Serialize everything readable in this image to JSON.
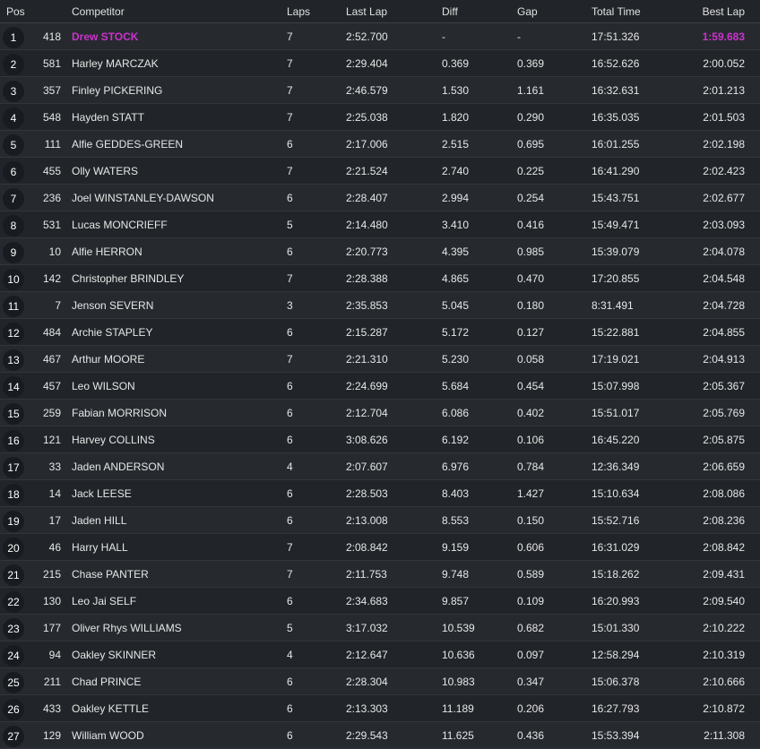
{
  "headers": {
    "pos": "Pos",
    "competitor": "Competitor",
    "laps": "Laps",
    "last_lap": "Last Lap",
    "diff": "Diff",
    "gap": "Gap",
    "total_time": "Total Time",
    "best_lap": "Best Lap"
  },
  "colors": {
    "background": "#212529",
    "row_alt": "#262a2f",
    "highlight": "#cc33cc",
    "badge": "#181b1f"
  },
  "rows": [
    {
      "pos": "1",
      "num": "418",
      "name": "Drew STOCK",
      "laps": "7",
      "last": "2:52.700",
      "diff": "-",
      "gap": "-",
      "total": "17:51.326",
      "best": "1:59.683",
      "leader": true,
      "fastest": true
    },
    {
      "pos": "2",
      "num": "581",
      "name": "Harley MARCZAK",
      "laps": "7",
      "last": "2:29.404",
      "diff": "0.369",
      "gap": "0.369",
      "total": "16:52.626",
      "best": "2:00.052"
    },
    {
      "pos": "3",
      "num": "357",
      "name": "Finley PICKERING",
      "laps": "7",
      "last": "2:46.579",
      "diff": "1.530",
      "gap": "1.161",
      "total": "16:32.631",
      "best": "2:01.213"
    },
    {
      "pos": "4",
      "num": "548",
      "name": "Hayden STATT",
      "laps": "7",
      "last": "2:25.038",
      "diff": "1.820",
      "gap": "0.290",
      "total": "16:35.035",
      "best": "2:01.503"
    },
    {
      "pos": "5",
      "num": "111",
      "name": "Alfie GEDDES-GREEN",
      "laps": "6",
      "last": "2:17.006",
      "diff": "2.515",
      "gap": "0.695",
      "total": "16:01.255",
      "best": "2:02.198"
    },
    {
      "pos": "6",
      "num": "455",
      "name": "Olly WATERS",
      "laps": "7",
      "last": "2:21.524",
      "diff": "2.740",
      "gap": "0.225",
      "total": "16:41.290",
      "best": "2:02.423"
    },
    {
      "pos": "7",
      "num": "236",
      "name": "Joel WINSTANLEY-DAWSON",
      "laps": "6",
      "last": "2:28.407",
      "diff": "2.994",
      "gap": "0.254",
      "total": "15:43.751",
      "best": "2:02.677"
    },
    {
      "pos": "8",
      "num": "531",
      "name": "Lucas MONCRIEFF",
      "laps": "5",
      "last": "2:14.480",
      "diff": "3.410",
      "gap": "0.416",
      "total": "15:49.471",
      "best": "2:03.093"
    },
    {
      "pos": "9",
      "num": "10",
      "name": "Alfie HERRON",
      "laps": "6",
      "last": "2:20.773",
      "diff": "4.395",
      "gap": "0.985",
      "total": "15:39.079",
      "best": "2:04.078"
    },
    {
      "pos": "10",
      "num": "142",
      "name": "Christopher BRINDLEY",
      "laps": "7",
      "last": "2:28.388",
      "diff": "4.865",
      "gap": "0.470",
      "total": "17:20.855",
      "best": "2:04.548"
    },
    {
      "pos": "11",
      "num": "7",
      "name": "Jenson SEVERN",
      "laps": "3",
      "last": "2:35.853",
      "diff": "5.045",
      "gap": "0.180",
      "total": "8:31.491",
      "best": "2:04.728"
    },
    {
      "pos": "12",
      "num": "484",
      "name": "Archie STAPLEY",
      "laps": "6",
      "last": "2:15.287",
      "diff": "5.172",
      "gap": "0.127",
      "total": "15:22.881",
      "best": "2:04.855"
    },
    {
      "pos": "13",
      "num": "467",
      "name": "Arthur MOORE",
      "laps": "7",
      "last": "2:21.310",
      "diff": "5.230",
      "gap": "0.058",
      "total": "17:19.021",
      "best": "2:04.913"
    },
    {
      "pos": "14",
      "num": "457",
      "name": "Leo WILSON",
      "laps": "6",
      "last": "2:24.699",
      "diff": "5.684",
      "gap": "0.454",
      "total": "15:07.998",
      "best": "2:05.367"
    },
    {
      "pos": "15",
      "num": "259",
      "name": "Fabian MORRISON",
      "laps": "6",
      "last": "2:12.704",
      "diff": "6.086",
      "gap": "0.402",
      "total": "15:51.017",
      "best": "2:05.769"
    },
    {
      "pos": "16",
      "num": "121",
      "name": "Harvey COLLINS",
      "laps": "6",
      "last": "3:08.626",
      "diff": "6.192",
      "gap": "0.106",
      "total": "16:45.220",
      "best": "2:05.875"
    },
    {
      "pos": "17",
      "num": "33",
      "name": "Jaden ANDERSON",
      "laps": "4",
      "last": "2:07.607",
      "diff": "6.976",
      "gap": "0.784",
      "total": "12:36.349",
      "best": "2:06.659"
    },
    {
      "pos": "18",
      "num": "14",
      "name": "Jack LEESE",
      "laps": "6",
      "last": "2:28.503",
      "diff": "8.403",
      "gap": "1.427",
      "total": "15:10.634",
      "best": "2:08.086"
    },
    {
      "pos": "19",
      "num": "17",
      "name": "Jaden HILL",
      "laps": "6",
      "last": "2:13.008",
      "diff": "8.553",
      "gap": "0.150",
      "total": "15:52.716",
      "best": "2:08.236"
    },
    {
      "pos": "20",
      "num": "46",
      "name": "Harry HALL",
      "laps": "7",
      "last": "2:08.842",
      "diff": "9.159",
      "gap": "0.606",
      "total": "16:31.029",
      "best": "2:08.842"
    },
    {
      "pos": "21",
      "num": "215",
      "name": "Chase PANTER",
      "laps": "7",
      "last": "2:11.753",
      "diff": "9.748",
      "gap": "0.589",
      "total": "15:18.262",
      "best": "2:09.431"
    },
    {
      "pos": "22",
      "num": "130",
      "name": "Leo Jai SELF",
      "laps": "6",
      "last": "2:34.683",
      "diff": "9.857",
      "gap": "0.109",
      "total": "16:20.993",
      "best": "2:09.540"
    },
    {
      "pos": "23",
      "num": "177",
      "name": "Oliver Rhys WILLIAMS",
      "laps": "5",
      "last": "3:17.032",
      "diff": "10.539",
      "gap": "0.682",
      "total": "15:01.330",
      "best": "2:10.222"
    },
    {
      "pos": "24",
      "num": "94",
      "name": "Oakley SKINNER",
      "laps": "4",
      "last": "2:12.647",
      "diff": "10.636",
      "gap": "0.097",
      "total": "12:58.294",
      "best": "2:10.319"
    },
    {
      "pos": "25",
      "num": "211",
      "name": "Chad PRINCE",
      "laps": "6",
      "last": "2:28.304",
      "diff": "10.983",
      "gap": "0.347",
      "total": "15:06.378",
      "best": "2:10.666"
    },
    {
      "pos": "26",
      "num": "433",
      "name": "Oakley KETTLE",
      "laps": "6",
      "last": "2:13.303",
      "diff": "11.189",
      "gap": "0.206",
      "total": "16:27.793",
      "best": "2:10.872"
    },
    {
      "pos": "27",
      "num": "129",
      "name": "William WOOD",
      "laps": "6",
      "last": "2:29.543",
      "diff": "11.625",
      "gap": "0.436",
      "total": "15:53.394",
      "best": "2:11.308"
    }
  ]
}
